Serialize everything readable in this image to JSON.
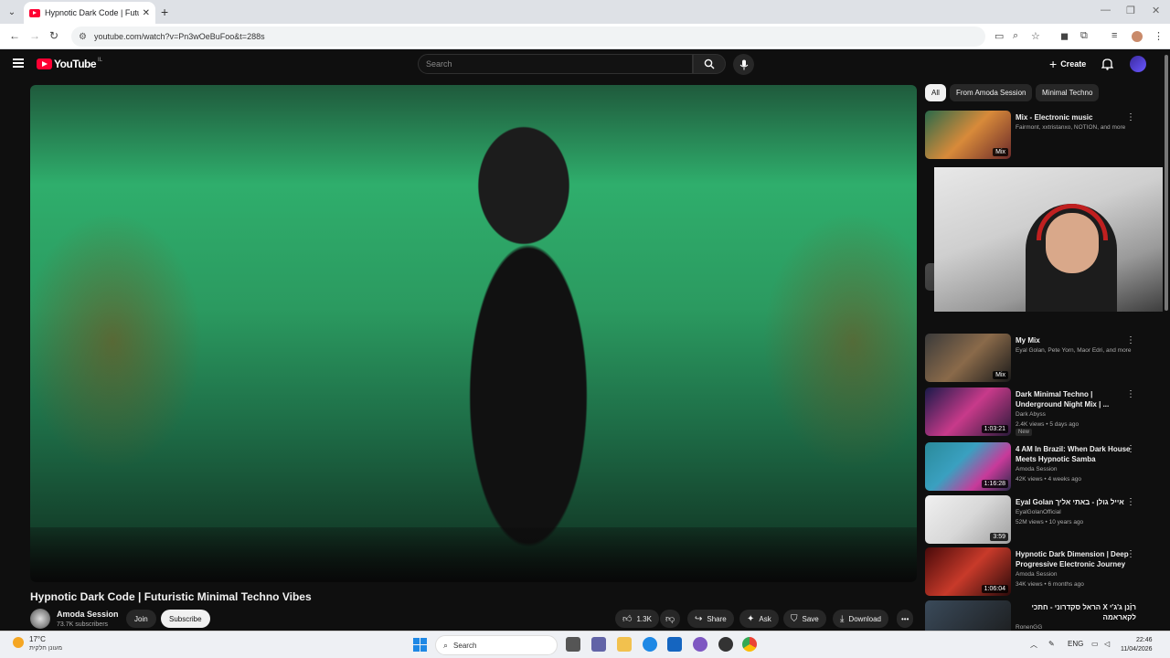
{
  "browser": {
    "tab_title": "Hypnotic Dark Code | Futuristic",
    "url": "youtube.com/watch?v=Pn3wOeBuFoo&t=288s"
  },
  "youtube": {
    "logo_text": "YouTube",
    "country": "IL",
    "search_placeholder": "Search",
    "create_label": "Create"
  },
  "video": {
    "title": "Hypnotic Dark Code | Futuristic Minimal Techno Vibes",
    "channel": "Amoda Session",
    "subscribers": "73.7K subscribers",
    "join_label": "Join",
    "subscribe_label": "Subscribe",
    "likes": "1.3K",
    "share_label": "Share",
    "ask_label": "Ask",
    "save_label": "Save",
    "download_label": "Download"
  },
  "chips": [
    "All",
    "From Amoda Session",
    "Minimal Techno"
  ],
  "recommendations": [
    {
      "title": "Mix - Electronic music",
      "meta1": "Fairmont, xxtristanxo, NOTION, and more",
      "meta2": "",
      "badge": "Mix",
      "new": ""
    },
    {
      "title": "My Mix",
      "meta1": "Eyal Golan, Pete Yorn, Maor Edri, and more",
      "meta2": "",
      "badge": "Mix",
      "new": ""
    },
    {
      "title": "Dark Minimal Techno | Underground Night Mix | ...",
      "meta1": "Dark Abyss",
      "meta2": "2.4K views • 5 days ago",
      "badge": "1:03:21",
      "new": "New"
    },
    {
      "title": "4 AM In Brazil: When Dark House Meets Hypnotic Samba",
      "meta1": "Amoda Session",
      "meta2": "42K views • 4 weeks ago",
      "badge": "1:16:28",
      "new": ""
    },
    {
      "title": "Eyal Golan אייל גולן - באתי אליך",
      "meta1": "EyalGolanOfficial",
      "meta2": "52M views • 10 years ago",
      "badge": "3:59",
      "new": ""
    },
    {
      "title": "Hypnotic Dark Dimension | Deep Progressive Electronic Journey",
      "meta1": "Amoda Session",
      "meta2": "34K views • 6 months ago",
      "badge": "1:06:04",
      "new": ""
    },
    {
      "title": "רונן ג'ג'י X הראל סקדרוני - חתכי לקאראמה",
      "meta1": "RonenGG",
      "meta2": "",
      "badge": "",
      "new": ""
    }
  ],
  "taskbar": {
    "temp": "17°C",
    "weather_desc": "מעונן חלקית",
    "search_label": "Search",
    "lang": "ENG",
    "time": "22:46",
    "date": "11/04/2026"
  }
}
